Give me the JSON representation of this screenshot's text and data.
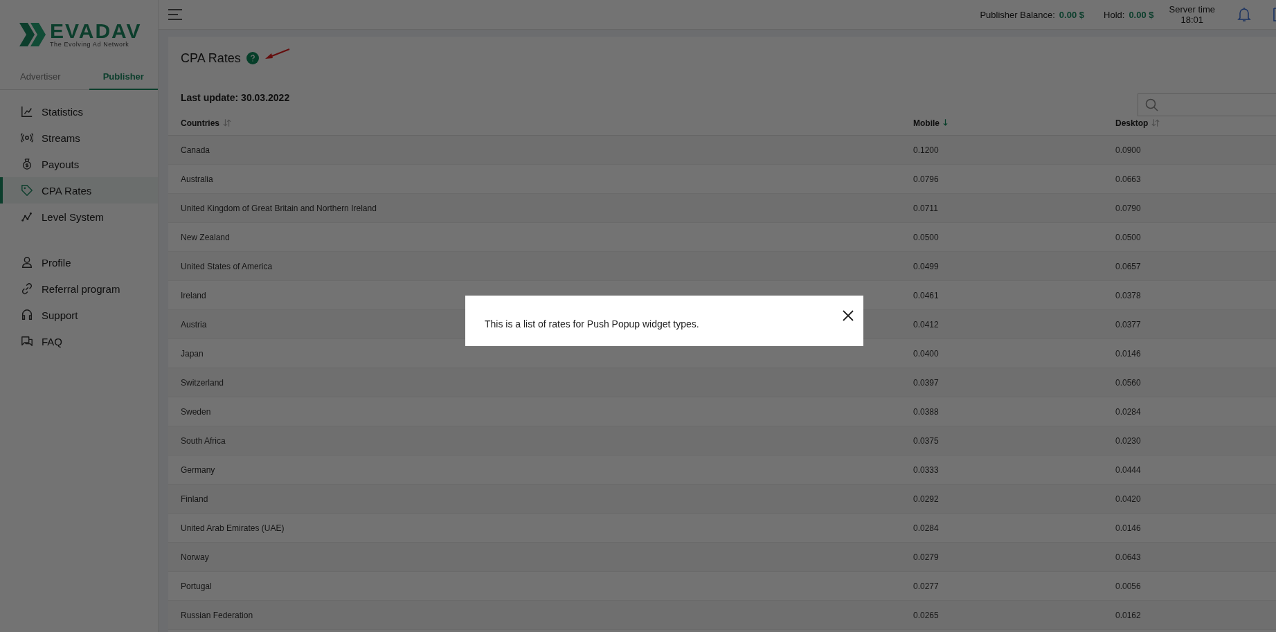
{
  "logo": {
    "name": "EVADAV",
    "tagline": "The Evolving Ad Network"
  },
  "account_tabs": [
    {
      "label": "Advertiser",
      "selected": false
    },
    {
      "label": "Publisher",
      "selected": true
    }
  ],
  "sidebar": {
    "groups": [
      [
        {
          "label": "Statistics",
          "selected": false
        },
        {
          "label": "Streams",
          "selected": false
        },
        {
          "label": "Payouts",
          "selected": false
        },
        {
          "label": "CPA Rates",
          "selected": true
        },
        {
          "label": "Level System",
          "selected": false
        }
      ],
      [
        {
          "label": "Profile",
          "selected": false
        },
        {
          "label": "Referral program",
          "selected": false
        },
        {
          "label": "Support",
          "selected": false
        },
        {
          "label": "FAQ",
          "selected": false
        }
      ]
    ]
  },
  "header": {
    "balance_label": "Publisher Balance:",
    "balance": "0.00 $",
    "hold_label": "Hold:",
    "hold": "0.00 $",
    "server_time_label": "Server time",
    "server_time": "18:01"
  },
  "page": {
    "title": "CPA Rates",
    "last_update": "Last update: 30.03.2022"
  },
  "table": {
    "columns": [
      {
        "label": "Countries",
        "sorted": false
      },
      {
        "label": "Mobile",
        "sorted": true
      },
      {
        "label": "Desktop",
        "sorted": false
      }
    ],
    "rows": [
      [
        "Canada",
        "0.1200",
        "0.0900"
      ],
      [
        "Australia",
        "0.0796",
        "0.0663"
      ],
      [
        "United Kingdom of Great Britain and Northern Ireland",
        "0.0711",
        "0.0790"
      ],
      [
        "New Zealand",
        "0.0500",
        "0.0500"
      ],
      [
        "United States of America",
        "0.0499",
        "0.0657"
      ],
      [
        "Ireland",
        "0.0461",
        "0.0378"
      ],
      [
        "Austria",
        "0.0412",
        "0.0377"
      ],
      [
        "Japan",
        "0.0400",
        "0.0146"
      ],
      [
        "Switzerland",
        "0.0397",
        "0.0560"
      ],
      [
        "Sweden",
        "0.0388",
        "0.0284"
      ],
      [
        "South Africa",
        "0.0375",
        "0.0230"
      ],
      [
        "Germany",
        "0.0333",
        "0.0444"
      ],
      [
        "Finland",
        "0.0292",
        "0.0420"
      ],
      [
        "United Arab Emirates (UAE)",
        "0.0284",
        "0.0146"
      ],
      [
        "Norway",
        "0.0279",
        "0.0643"
      ],
      [
        "Portugal",
        "0.0277",
        "0.0056"
      ],
      [
        "Russian Federation",
        "0.0265",
        "0.0162"
      ]
    ]
  },
  "dialog": {
    "message": "This is a list of rates for Push Popup widget types."
  }
}
